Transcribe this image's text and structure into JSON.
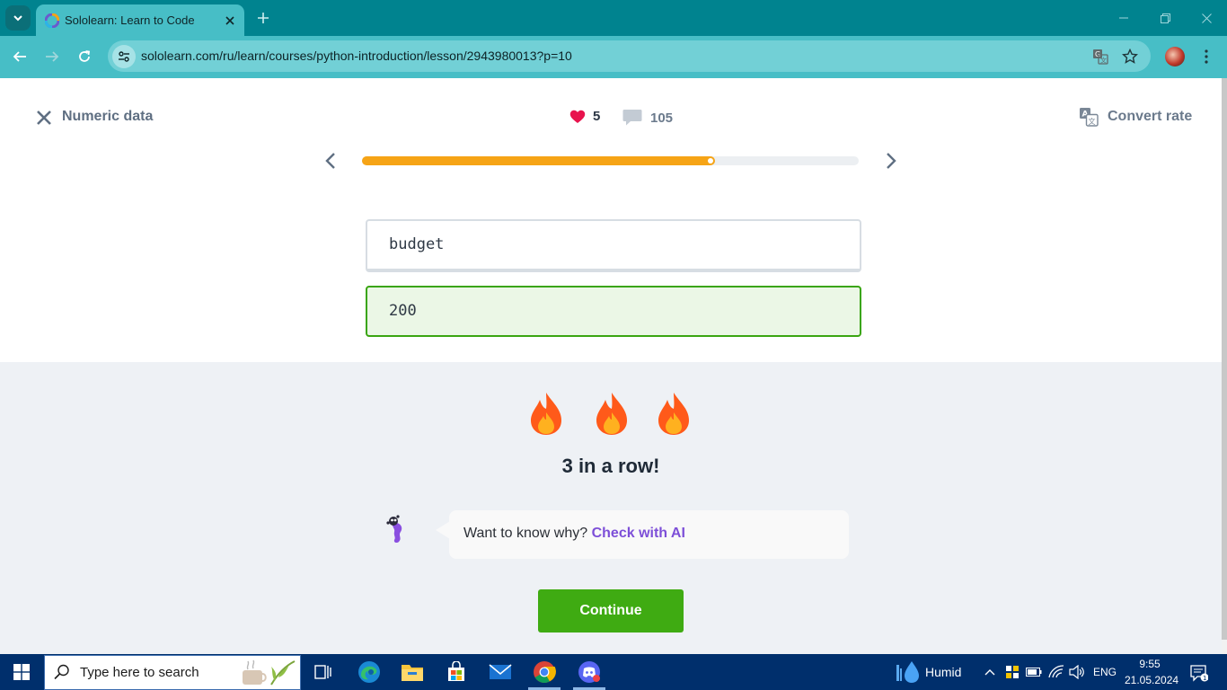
{
  "browser": {
    "tab_title": "Sololearn: Learn to Code",
    "url": "sololearn.com/ru/learn/courses/python-introduction/lesson/2943980013?p=10"
  },
  "lesson": {
    "title": "Numeric data",
    "hearts": "5",
    "comments": "105",
    "convert_label": "Convert rate",
    "progress": 0.71
  },
  "exercise": {
    "code": "budget",
    "answer": "200"
  },
  "result": {
    "streak_count": 3,
    "streak_text": "3 in a row!",
    "ai_prompt": "Want to know why?",
    "ai_link": "Check with AI",
    "continue_label": "Continue"
  },
  "colors": {
    "accent_green": "#3fab12",
    "progress_orange": "#f6a416",
    "ai_purple": "#7d4fd8",
    "browser_teal": "#00838f"
  },
  "taskbar": {
    "search_placeholder": "Type here to search",
    "weather": "Humid",
    "language": "ENG",
    "time": "9:55",
    "date": "21.05.2024",
    "notifications": "1",
    "apps": [
      "task-view-icon",
      "edge-icon",
      "file-explorer-icon",
      "store-icon",
      "mail-icon",
      "chrome-icon",
      "discord-icon"
    ]
  }
}
